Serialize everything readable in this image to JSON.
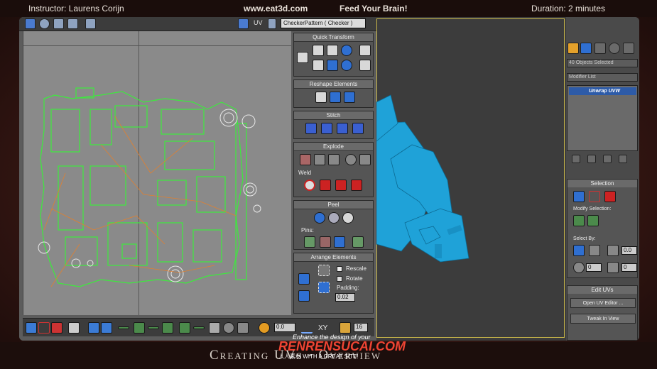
{
  "header": {
    "instructor": "Instructor: Laurens Corijn",
    "site": "www.eat3d.com",
    "tagline": "Feed Your Brain!",
    "duration": "Duration: 2 minutes"
  },
  "footer": {
    "title": "Creating UVs - Overview"
  },
  "watermark": {
    "line1": "Enhance the design of your",
    "line2": "RENRENSUCAI.COM",
    "line3": "人人素材 WITH A GREAT SITE!"
  },
  "uv_editor": {
    "uv_label": "UV",
    "texture_dropdown": "CheckerPattern ( Checker )",
    "rollouts": {
      "quick_transform": "Quick Transform",
      "reshape": "Reshape Elements",
      "stitch": "Stitch",
      "explode": "Explode",
      "weld": "Weld",
      "peel": "Peel",
      "pins": "Pins:",
      "arrange": "Arrange Elements",
      "rescale": "Rescale",
      "rotate": "Rotate",
      "padding": "Padding:",
      "padding_value": "0.02"
    },
    "bottom": {
      "value1": "0.0",
      "xy": "XY",
      "value2": "16"
    }
  },
  "command_panel": {
    "selection_info": "40 Objects Selected",
    "modifier_list": "Modifier List",
    "modifier_item": "Unwrap UVW",
    "selection_rollout": "Selection",
    "modify_selection": "Modify Selection:",
    "select_by": "Select By:",
    "spin1": "0.0",
    "spin2": "0",
    "spin3": "0",
    "edit_uvs": "Edit UVs",
    "open_uv_editor": "Open UV Editor ...",
    "tweak_in_view": "Tweak In View"
  }
}
